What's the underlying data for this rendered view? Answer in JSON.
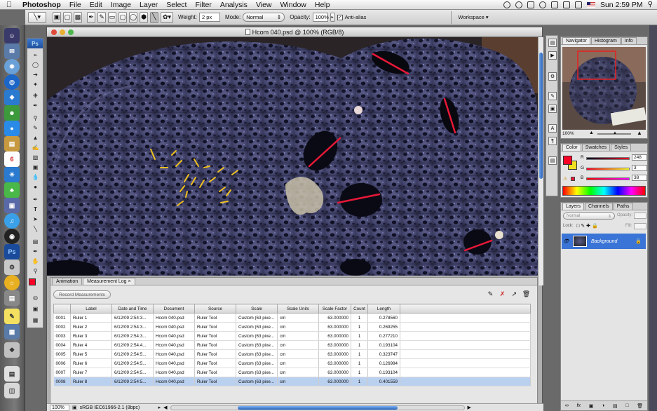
{
  "menubar": {
    "app": "Photoshop",
    "items": [
      "File",
      "Edit",
      "Image",
      "Layer",
      "Select",
      "Filter",
      "Analysis",
      "View",
      "Window",
      "Help"
    ],
    "clock": "Sun 2:59 PM"
  },
  "options": {
    "weight_label": "Weight:",
    "weight_value": "2 px",
    "mode_label": "Mode:",
    "mode_value": "Normal",
    "opacity_label": "Opacity:",
    "opacity_value": "100%",
    "antialias_label": "Anti-alias",
    "workspace_label": "Workspace"
  },
  "tools": {
    "badge": "Ps"
  },
  "document": {
    "title": "Hcom  040.psd @ 100% (RGB/8)",
    "zoom": "100%",
    "status": "sRGB IEC61966-2.1 (8bpc)"
  },
  "log_panel": {
    "tabs": [
      "Animation",
      "Measurement Log"
    ],
    "record_button": "Record Measurements",
    "columns": [
      "",
      "Label",
      "Date and Time",
      "Document",
      "Source",
      "Scale",
      "Scale Units",
      "Scale Factor",
      "Count",
      "Length"
    ],
    "rows": [
      {
        "id": "0001",
        "label": "Ruler 1",
        "date": "6/12/09 2:54:3...",
        "doc": "Hcom  040.psd",
        "source": "Ruler Tool",
        "scale": "Custom (63 pixe...",
        "units": "cm",
        "factor": "63.000000",
        "count": "1",
        "length": "0.278560"
      },
      {
        "id": "0002",
        "label": "Ruler 2",
        "date": "6/12/09 2:54:3...",
        "doc": "Hcom  040.psd",
        "source": "Ruler Tool",
        "scale": "Custom (63 pixe...",
        "units": "cm",
        "factor": "63.000000",
        "count": "1",
        "length": "0.269255"
      },
      {
        "id": "0003",
        "label": "Ruler 3",
        "date": "6/12/09 2:54:3...",
        "doc": "Hcom  040.psd",
        "source": "Ruler Tool",
        "scale": "Custom (63 pixe...",
        "units": "cm",
        "factor": "63.000000",
        "count": "1",
        "length": "0.277210"
      },
      {
        "id": "0004",
        "label": "Ruler 4",
        "date": "6/12/09 2:54:4...",
        "doc": "Hcom  040.psd",
        "source": "Ruler Tool",
        "scale": "Custom (63 pixe...",
        "units": "cm",
        "factor": "63.000000",
        "count": "1",
        "length": "0.193104"
      },
      {
        "id": "0005",
        "label": "Ruler 5",
        "date": "6/12/09 2:54:5...",
        "doc": "Hcom  040.psd",
        "source": "Ruler Tool",
        "scale": "Custom (63 pixe...",
        "units": "cm",
        "factor": "63.000000",
        "count": "1",
        "length": "0.323747"
      },
      {
        "id": "0006",
        "label": "Ruler 6",
        "date": "6/12/09 2:54:5...",
        "doc": "Hcom  040.psd",
        "source": "Ruler Tool",
        "scale": "Custom (63 pixe...",
        "units": "cm",
        "factor": "63.000000",
        "count": "1",
        "length": "0.126984"
      },
      {
        "id": "0007",
        "label": "Ruler 7",
        "date": "6/12/09 2:54:5...",
        "doc": "Hcom  040.psd",
        "source": "Ruler Tool",
        "scale": "Custom (63 pixe...",
        "units": "cm",
        "factor": "63.000000",
        "count": "1",
        "length": "0.193104"
      },
      {
        "id": "0008",
        "label": "Ruler 8",
        "date": "6/12/09 2:54:5...",
        "doc": "Hcom  040.psd",
        "source": "Ruler Tool",
        "scale": "Custom (63 pixe...",
        "units": "cm",
        "factor": "63.000000",
        "count": "1",
        "length": "0.401559"
      }
    ],
    "selected_row": "0008"
  },
  "navigator": {
    "tabs": [
      "Navigator",
      "Histogram",
      "Info"
    ],
    "zoom": "100%"
  },
  "color": {
    "tabs": [
      "Color",
      "Swatches",
      "Styles"
    ],
    "r": "248",
    "g": "3",
    "b": "38",
    "fg": "#f80326",
    "labels": [
      "R",
      "G",
      "B"
    ]
  },
  "layers": {
    "tabs": [
      "Layers",
      "Channels",
      "Paths"
    ],
    "mode": "Normal",
    "opacity_label": "Opacity:",
    "fill_label": "Fill:",
    "lock_label": "Lock:",
    "layer_name": "Background"
  }
}
